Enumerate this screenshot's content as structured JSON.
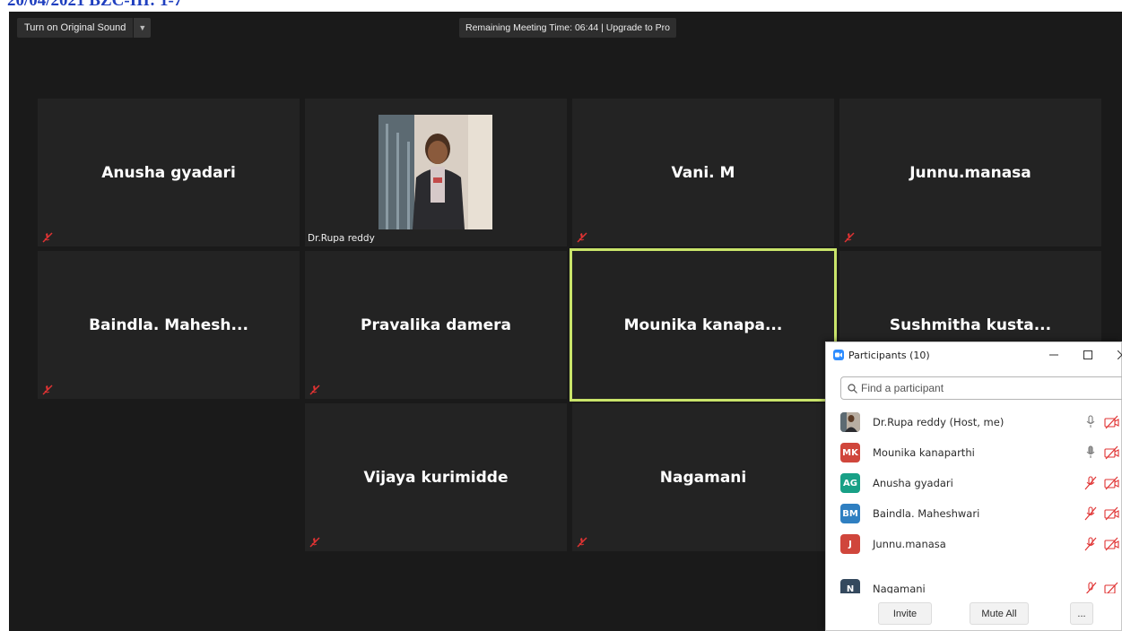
{
  "document": {
    "header": "20/04/2021 BZC-III: 1-7"
  },
  "meeting": {
    "original_sound_label": "Turn on Original Sound",
    "remaining_time": "Remaining Meeting Time: 06:44 | Upgrade to Pro",
    "active_speaker_color": "#c9e46a"
  },
  "tiles": [
    {
      "name": "Anusha gyadari",
      "muted": true
    },
    {
      "name": "Dr.Rupa reddy",
      "video": true
    },
    {
      "name": "Vani. M",
      "muted": true
    },
    {
      "name": "Junnu.manasa",
      "muted": true
    },
    {
      "name": "Baindla. Mahesh...",
      "muted": true
    },
    {
      "name": "Pravalika damera",
      "muted": true
    },
    {
      "name": "Mounika  kanapa...",
      "active": true
    },
    {
      "name": "Sushmitha  kusta..."
    },
    {
      "name": "Vijaya kurimidde",
      "muted": true
    },
    {
      "name": "Nagamani",
      "muted": true
    }
  ],
  "participants_panel": {
    "title": "Participants (10)",
    "search_placeholder": "Find a participant",
    "participants": [
      {
        "initials": "",
        "name": "Dr.Rupa reddy (Host, me)",
        "avatar_color": "#6d7d8c",
        "mic": "on",
        "video": "off"
      },
      {
        "initials": "MK",
        "name": "Mounika kanaparthi",
        "avatar_color": "#d0463c",
        "mic": "on",
        "video": "off"
      },
      {
        "initials": "AG",
        "name": "Anusha gyadari",
        "avatar_color": "#18a086",
        "mic": "muted",
        "video": "off"
      },
      {
        "initials": "BM",
        "name": "Baindla. Maheshwari",
        "avatar_color": "#2f7fc1",
        "mic": "muted",
        "video": "off"
      },
      {
        "initials": "J",
        "name": "Junnu.manasa",
        "avatar_color": "#d0463c",
        "mic": "muted",
        "video": "off"
      },
      {
        "initials": "N",
        "name": "Nagamani",
        "avatar_color": "#34495e",
        "mic": "muted",
        "video": "off"
      }
    ],
    "buttons": {
      "invite": "Invite",
      "mute_all": "Mute All",
      "more": "..."
    }
  },
  "icons": {
    "muted_mic": "muted-mic-icon",
    "mic": "mic-icon",
    "video_off": "video-off-icon",
    "search": "search-icon",
    "dropdown": "chevron-down-icon"
  }
}
